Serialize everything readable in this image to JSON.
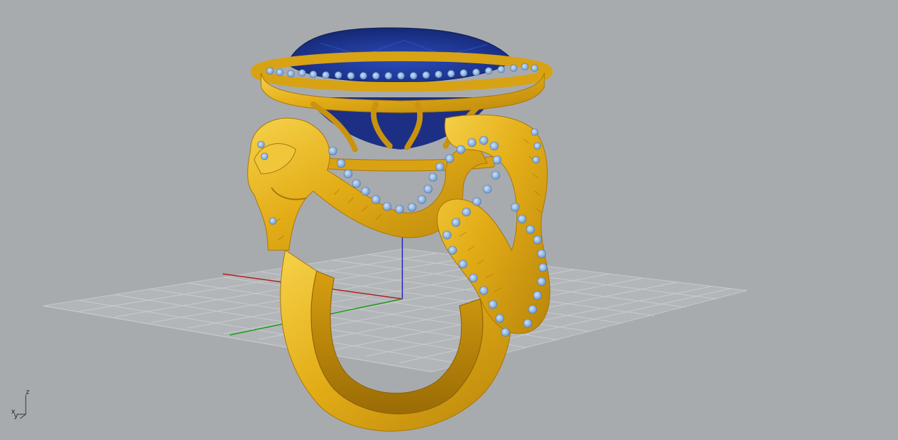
{
  "viewport": {
    "background_color": "#a8abae",
    "display_mode": "rendered",
    "grid_color": "#c8cacc",
    "x_axis_color": "#b02020",
    "y_axis_color": "#1c9a1c",
    "z_axis_color": "#2424c8"
  },
  "model": {
    "object": "dragon-ring",
    "metal_color": "#e0ae18",
    "gemstone_color": "#1e3a9a",
    "accent_stones_color": "#8ab4e2"
  },
  "axis_gizmo": {
    "z_label": "z",
    "y_label": "y",
    "x_label": "x"
  }
}
